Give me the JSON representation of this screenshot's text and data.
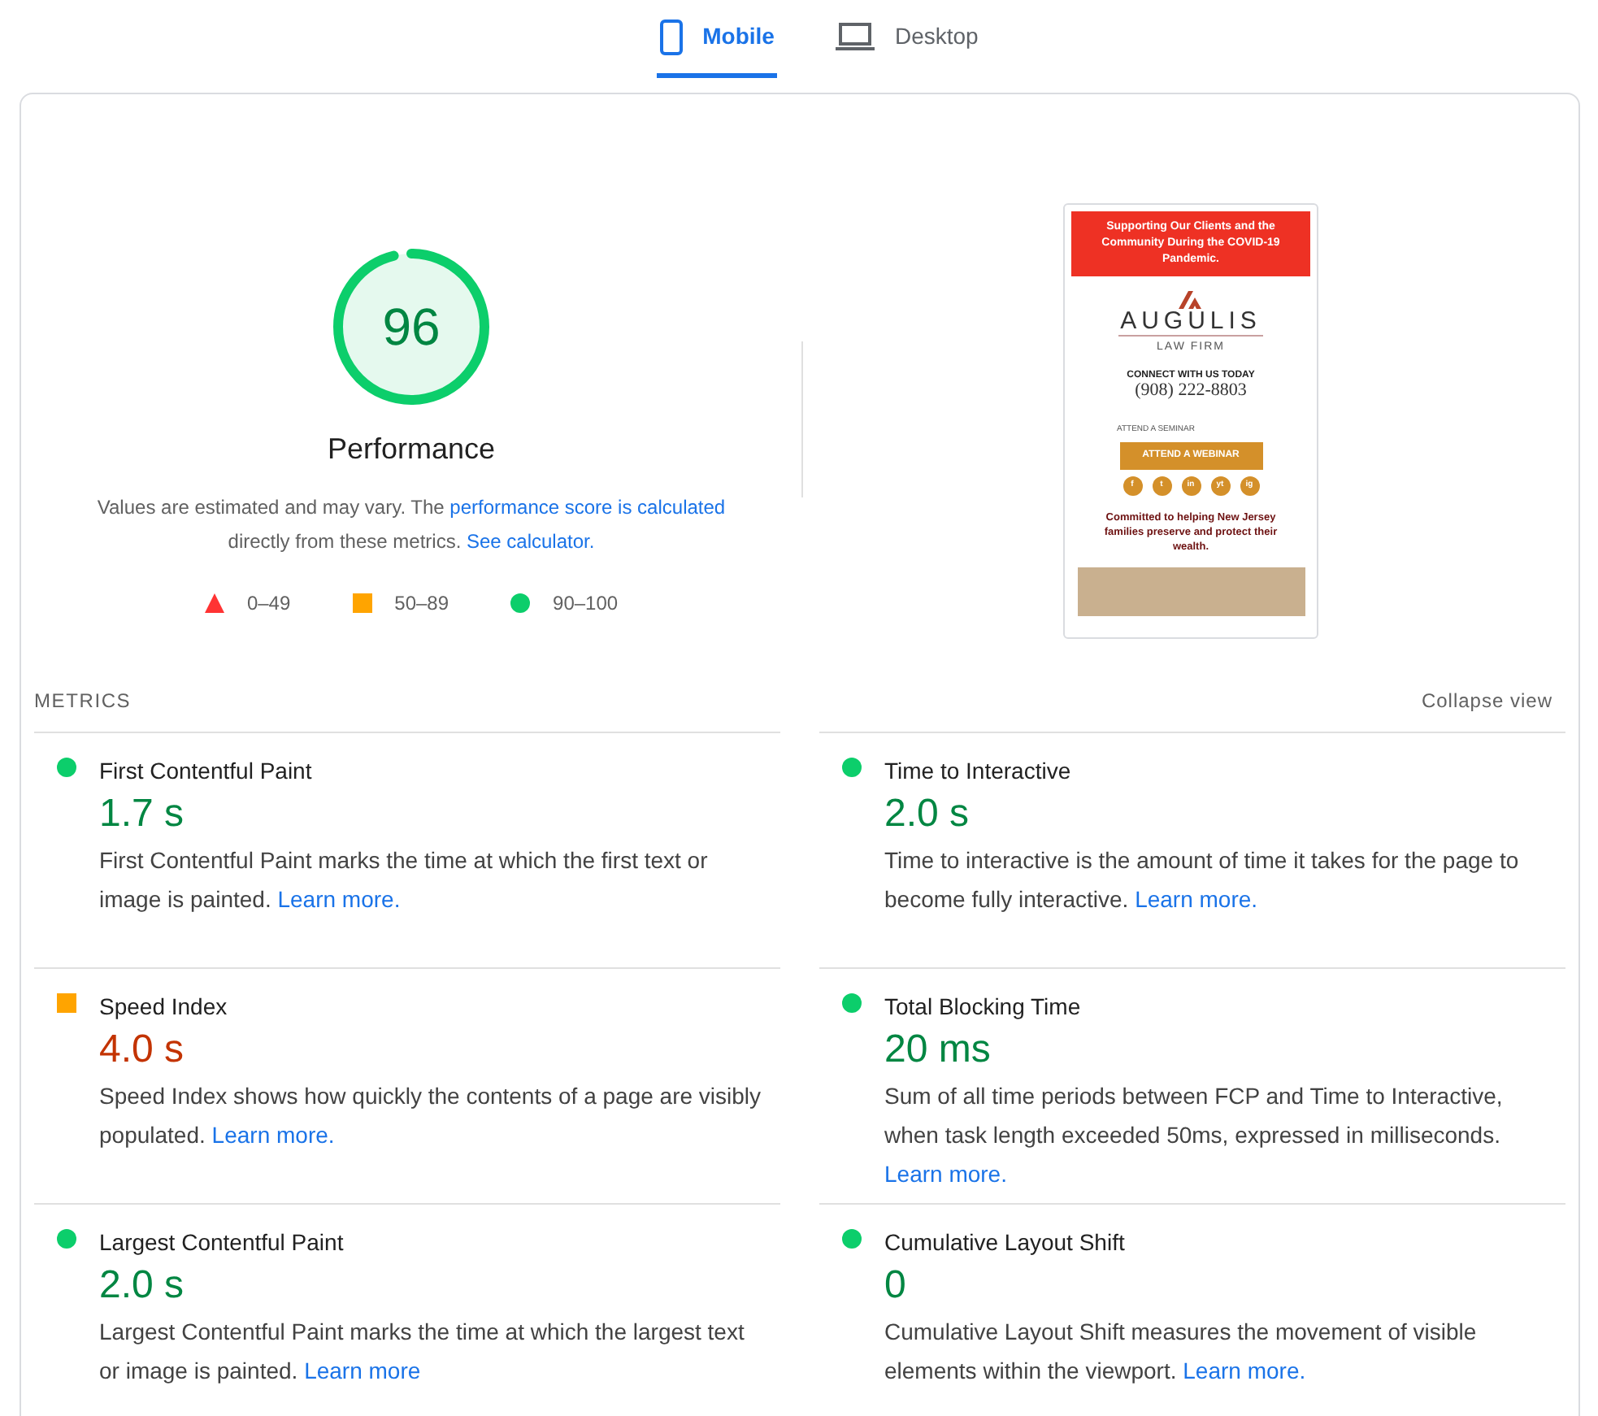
{
  "tabs": [
    {
      "label": "Mobile",
      "kind": "mobile",
      "selected": true
    },
    {
      "label": "Desktop",
      "kind": "desktop",
      "selected": false
    }
  ],
  "gauge": {
    "score": "96",
    "level": 0.96,
    "title": "Performance"
  },
  "note": {
    "text": "Values are estimated and may vary. The ",
    "link": "performance score is calculated",
    "text_2": " directly from these metrics. ",
    "link_2": "See calculator."
  },
  "legend": [
    {
      "kind": "triangle",
      "color": "#ff3333",
      "label": "0–49"
    },
    {
      "kind": "square",
      "color": "#ffa400",
      "label": "50–89"
    },
    {
      "kind": "circle",
      "color": "#0cce6b",
      "label": "90–100"
    }
  ],
  "screenshot": {
    "banner": "Supporting Our Clients and the Community During the COVID-19 Pandemic.",
    "brand": "AUGULIS",
    "subbrand": "LAW FIRM",
    "connect": "CONNECT WITH US TODAY",
    "phone": "(908) 222-8803",
    "seminar": "ATTEND A SEMINAR",
    "button": "ATTEND A WEBINAR",
    "social": [
      "f",
      "t",
      "in",
      "yt",
      "ig"
    ],
    "tagline": "Committed to helping New Jersey families preserve and protect their wealth."
  },
  "metrics_heading": "METRICS",
  "collapse": "Collapse view",
  "metrics": [
    {
      "title": "First Contentful Paint",
      "value": "1.7 s",
      "kind": "circle",
      "color": "#0cce6b",
      "description": "First Contentful Paint marks the time at which the first text or image is painted. ",
      "link": "Learn more."
    },
    {
      "title": "Time to Interactive",
      "value": "2.0 s",
      "kind": "circle",
      "color": "#0cce6b",
      "description": "Time to interactive is the amount of time it takes for the page to become fully interactive. ",
      "link": "Learn more."
    },
    {
      "title": "Speed Index",
      "value": "4.0 s",
      "kind": "square",
      "color": "#ffa400",
      "description": "Speed Index shows how quickly the contents of a page are visibly populated. ",
      "link": "Learn more."
    },
    {
      "title": "Total Blocking Time",
      "value": "20 ms",
      "kind": "circle",
      "color": "#0cce6b",
      "description": "Sum of all time periods between FCP and Time to Interactive, when task length exceeded 50ms, expressed in milliseconds. ",
      "link": "Learn more."
    },
    {
      "title": "Largest Contentful Paint",
      "value": "2.0 s",
      "kind": "circle",
      "color": "#0cce6b",
      "description": "Largest Contentful Paint marks the time at which the largest text or image is painted. ",
      "link": "Learn more"
    },
    {
      "title": "Cumulative Layout Shift",
      "value": "0",
      "kind": "circle",
      "color": "#0cce6b",
      "description": "Cumulative Layout Shift measures the movement of visible elements within the viewport. ",
      "link": "Learn more."
    }
  ]
}
